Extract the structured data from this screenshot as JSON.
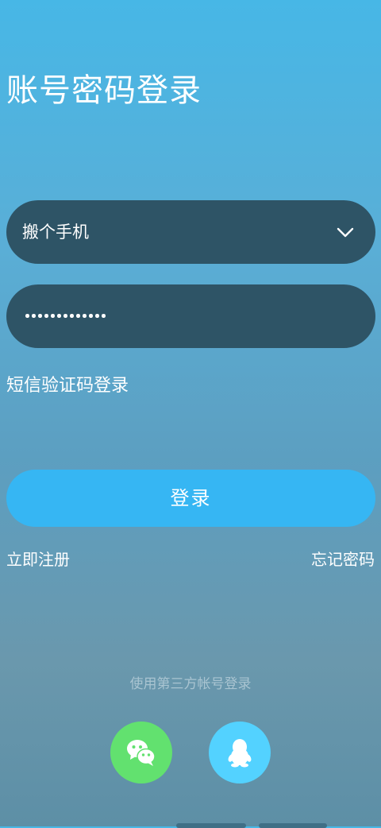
{
  "page": {
    "title": "账号密码登录"
  },
  "form": {
    "account_value": "搬个手机",
    "password_masked": "•••••••••••••",
    "password_length": 13,
    "sms_login_label": "短信验证码登录",
    "submit_label": "登录"
  },
  "links": {
    "register": "立即注册",
    "forgot_password": "忘记密码"
  },
  "third_party": {
    "caption": "使用第三方帐号登录",
    "providers": [
      "wechat-icon",
      "qq-icon"
    ]
  },
  "colors": {
    "field_background": "#2e5466",
    "login_button": "#36b6f3",
    "wechat": "#62e16f",
    "qq": "#53d2ff"
  }
}
